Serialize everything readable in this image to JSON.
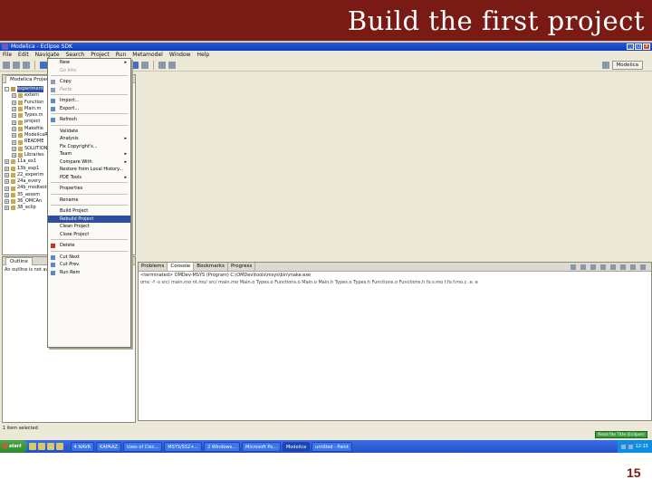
{
  "slide": {
    "title": "Build the first project",
    "page_number": "15",
    "header_color": "#7a1a14"
  },
  "window": {
    "title": "Modelica - Eclipse SDK",
    "menu": [
      "File",
      "Edit",
      "Navigate",
      "Search",
      "Project",
      "Run",
      "Metamodel",
      "Window",
      "Help"
    ]
  },
  "perspective": {
    "label": "Modelica"
  },
  "project_explorer": {
    "tab_label": "Modelica Projects",
    "items": [
      {
        "label": "experiment",
        "expanded": true,
        "selected": true
      },
      {
        "label": "extern"
      },
      {
        "label": "Function"
      },
      {
        "label": "Main.m"
      },
      {
        "label": "Types.m"
      },
      {
        "label": "project"
      },
      {
        "label": "Makefile"
      },
      {
        "label": "ModelicaR"
      },
      {
        "label": "README"
      },
      {
        "label": "SOLUTION"
      },
      {
        "label": "Libraries"
      },
      {
        "label": "11a_ex1"
      },
      {
        "label": "13b_exp1"
      },
      {
        "label": "22_experim"
      },
      {
        "label": "24a_every"
      },
      {
        "label": "24b_modtest"
      },
      {
        "label": "35_assem"
      },
      {
        "label": "36_OMCAn"
      },
      {
        "label": "38_eclip"
      }
    ]
  },
  "outline": {
    "tab_label": "Outline",
    "message": "An outline is not available."
  },
  "context_menu": {
    "items": [
      {
        "label": "New",
        "submenu": true
      },
      {
        "label": "Go Into",
        "dim": true
      },
      {
        "sep": true
      },
      {
        "label": "Copy",
        "icon": "copy-icon"
      },
      {
        "label": "Paste",
        "dim": true,
        "icon": "paste-icon"
      },
      {
        "sep": true
      },
      {
        "label": "Import...",
        "icon": "import-icon"
      },
      {
        "label": "Export...",
        "icon": "export-icon"
      },
      {
        "sep": true
      },
      {
        "label": "Refresh",
        "icon": "refresh-icon"
      },
      {
        "sep": true
      },
      {
        "label": "Validate"
      },
      {
        "label": "Analysis",
        "submenu": true
      },
      {
        "label": "Fix Copyright's..."
      },
      {
        "label": "Team",
        "submenu": true
      },
      {
        "label": "Compare With",
        "submenu": true
      },
      {
        "label": "Restore from Local History..."
      },
      {
        "label": "PDE Tools",
        "submenu": true
      },
      {
        "sep": true
      },
      {
        "label": "Properties"
      },
      {
        "sep": true
      },
      {
        "label": "Rename"
      },
      {
        "sep": true
      },
      {
        "label": "Build Project"
      },
      {
        "label": "Rebuild Project",
        "selected": true
      },
      {
        "label": "Clean Project"
      },
      {
        "label": "Close Project"
      },
      {
        "sep": true
      },
      {
        "label": "Delete",
        "icon": "delete-icon"
      },
      {
        "sep": true
      },
      {
        "label": "Cut Next",
        "icon": "cut-icon"
      },
      {
        "label": "Cut Prev.",
        "icon": "cut-icon"
      },
      {
        "label": "Run Rem",
        "icon": "run-icon"
      }
    ]
  },
  "console": {
    "tabs": [
      "Problems",
      "Console",
      "Bookmarks",
      "Progress"
    ],
    "active_tab": "Console",
    "header_line": "<terminated> OMDev-MSYS (Program) C:\\OMDev\\tools\\msys\\bin\\make.exe",
    "output_line": "omc -f -s src/ main.mo nt.mo/ src/ main.mo Main.o Types.o Functions.o Main.o Main.h Types.o Types.h Functions.o Functions.h fo.s.mo f.fo.f.mo.c .e. e"
  },
  "status": {
    "left": "1 item selected",
    "button": "Read file Title (Eclipse)"
  },
  "taskbar": {
    "start": "start",
    "tasks": [
      "4 NAVR",
      "KAPAAZ",
      "Uses of Clec...",
      "MSYS/SS2+...",
      "2 Windows...",
      "Microsoft Po...",
      "Modelica",
      "untitled - Paint"
    ],
    "active_task": "Modelica",
    "clock": "12:15"
  }
}
